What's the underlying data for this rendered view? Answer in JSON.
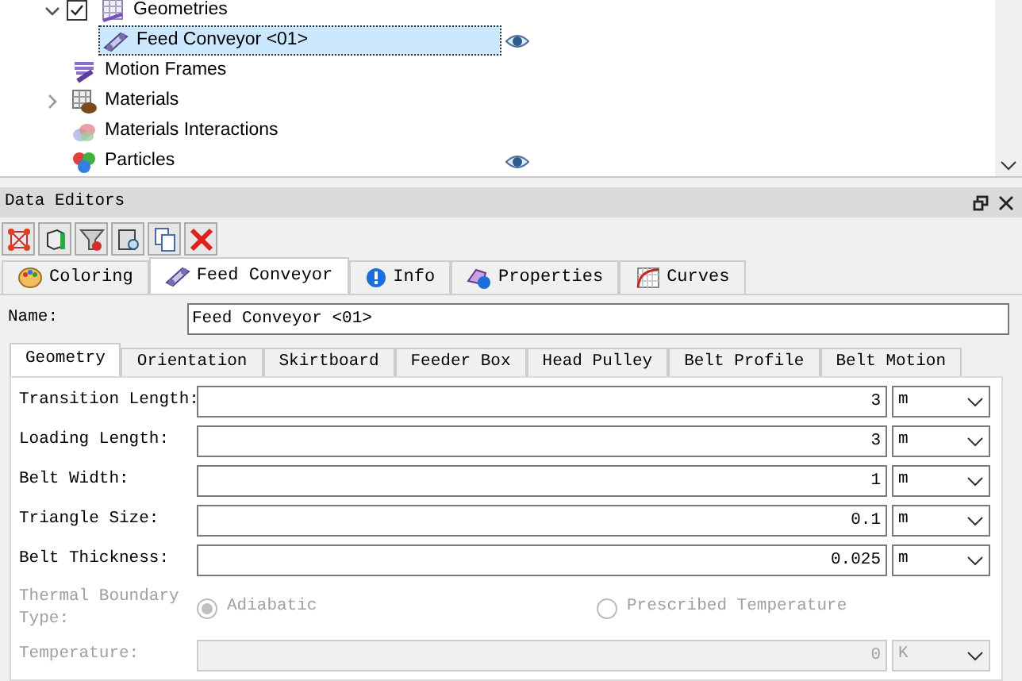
{
  "tree": {
    "items": [
      {
        "label": "Geometries",
        "expanded": true,
        "checked": true,
        "children": [
          {
            "label": "Feed Conveyor <01>",
            "selected": true,
            "visible": true
          }
        ]
      },
      {
        "label": "Motion Frames",
        "selected": false
      },
      {
        "label": "Materials",
        "expanded": false,
        "selected": false
      },
      {
        "label": "Materials Interactions",
        "selected": false
      },
      {
        "label": "Particles",
        "selected": false,
        "visible": true
      }
    ]
  },
  "panel": {
    "title": "Data Editors",
    "tabs": [
      {
        "label": "Coloring",
        "selected": false
      },
      {
        "label": "Feed Conveyor",
        "selected": true
      },
      {
        "label": "Info",
        "selected": false
      },
      {
        "label": "Properties",
        "selected": false
      },
      {
        "label": "Curves",
        "selected": false
      }
    ],
    "name_field": {
      "label": "Name:",
      "value": "Feed Conveyor <01>"
    },
    "subtabs": [
      {
        "label": "Geometry",
        "selected": true
      },
      {
        "label": "Orientation",
        "selected": false
      },
      {
        "label": "Skirtboard",
        "selected": false
      },
      {
        "label": "Feeder Box",
        "selected": false
      },
      {
        "label": "Head Pulley",
        "selected": false
      },
      {
        "label": "Belt Profile",
        "selected": false
      },
      {
        "label": "Belt Motion",
        "selected": false
      }
    ],
    "fields": [
      {
        "label": "Transition Length:",
        "value": "3",
        "unit": "m",
        "disabled": false
      },
      {
        "label": "Loading Length:",
        "value": "3",
        "unit": "m",
        "disabled": false
      },
      {
        "label": "Belt Width:",
        "value": "1",
        "unit": "m",
        "disabled": false
      },
      {
        "label": "Triangle Size:",
        "value": "0.1",
        "unit": "m",
        "disabled": false
      },
      {
        "label": "Belt Thickness:",
        "value": "0.025",
        "unit": "m",
        "disabled": false
      }
    ],
    "thermal": {
      "label": "Thermal Boundary Type:",
      "disabled": true,
      "options": [
        {
          "label": "Adiabatic",
          "selected": true
        },
        {
          "label": "Prescribed Temperature",
          "selected": false
        }
      ]
    },
    "temperature": {
      "label": "Temperature:",
      "value": "0",
      "unit": "K",
      "disabled": true
    }
  }
}
